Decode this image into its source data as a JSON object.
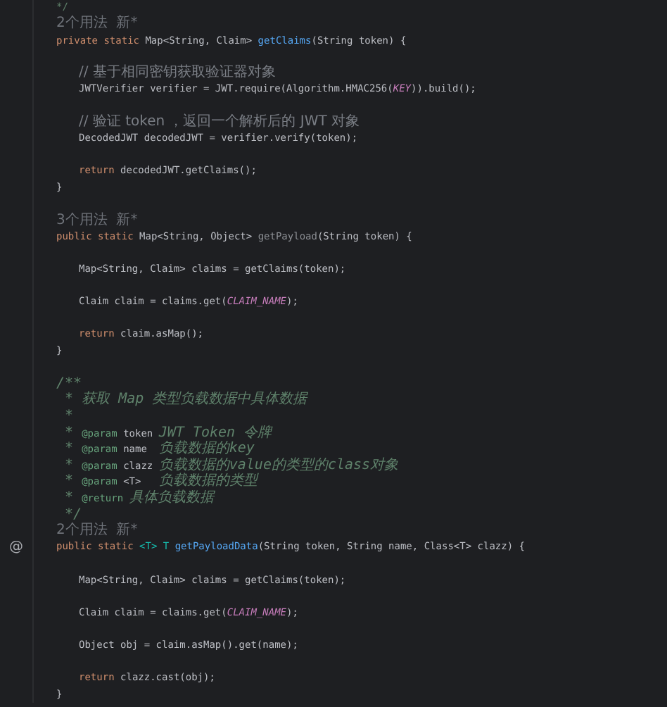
{
  "leading_comment_end": "*/",
  "members": [
    {
      "usage": "2个用法  新*",
      "signature": [
        {
          "text": "private static ",
          "kind": "kw"
        },
        {
          "text": "Map<String, Claim> ",
          "kind": "plain"
        },
        {
          "text": "getClaims",
          "kind": "fn"
        },
        {
          "text": "(String token) {",
          "kind": "plain"
        }
      ],
      "body": [
        {
          "comment": "// 基于相同密钥获取验证器对象",
          "code": [
            {
              "text": "JWTVerifier verifier = JWT.require(Algorithm.HMAC256(",
              "kind": "plain"
            },
            {
              "text": "KEY",
              "kind": "const"
            },
            {
              "text": ")).build();",
              "kind": "plain"
            }
          ]
        },
        {
          "comment": "// 验证 token ，返回一个解析后的 JWT 对象",
          "code": [
            {
              "text": "DecodedJWT decodedJWT = verifier.verify(token);",
              "kind": "plain"
            }
          ]
        },
        {
          "code": [
            {
              "text": "return ",
              "kind": "kw"
            },
            {
              "text": "decodedJWT.getClaims();",
              "kind": "plain"
            }
          ]
        }
      ],
      "closing": "}"
    },
    {
      "usage": "3个用法  新*",
      "signature": [
        {
          "text": "public static ",
          "kind": "kw"
        },
        {
          "text": "Map<String, Object> ",
          "kind": "plain"
        },
        {
          "text": "getPayload",
          "kind": "unused"
        },
        {
          "text": "(String token) {",
          "kind": "plain"
        }
      ],
      "body": [
        {
          "code": [
            {
              "text": "Map<String, Claim> claims = getClaims(token);",
              "kind": "plain"
            }
          ]
        },
        {
          "code": [
            {
              "text": "Claim claim = claims.get(",
              "kind": "plain"
            },
            {
              "text": "CLAIM_NAME",
              "kind": "const"
            },
            {
              "text": ");",
              "kind": "plain"
            }
          ]
        },
        {
          "code": [
            {
              "text": "return ",
              "kind": "kw"
            },
            {
              "text": "claim.asMap();",
              "kind": "plain"
            }
          ]
        }
      ],
      "closing": "}"
    },
    {
      "doc": [
        [
          {
            "text": "/**",
            "kind": "doc"
          }
        ],
        [
          {
            "text": " * ",
            "kind": "doc"
          },
          {
            "text": "获取 Map 类型负载数据中具体数据",
            "kind": "doc"
          }
        ],
        [
          {
            "text": " *",
            "kind": "doc"
          }
        ],
        [
          {
            "text": " * ",
            "kind": "doc"
          },
          {
            "text": "@param ",
            "kind": "tag"
          },
          {
            "text": "token ",
            "kind": "docp"
          },
          {
            "text": "JWT Token 令牌",
            "kind": "doc"
          }
        ],
        [
          {
            "text": " * ",
            "kind": "doc"
          },
          {
            "text": "@param ",
            "kind": "tag"
          },
          {
            "text": "name  ",
            "kind": "docp"
          },
          {
            "text": "负载数据的key",
            "kind": "doc"
          }
        ],
        [
          {
            "text": " * ",
            "kind": "doc"
          },
          {
            "text": "@param ",
            "kind": "tag"
          },
          {
            "text": "clazz ",
            "kind": "docp"
          },
          {
            "text": "负载数据的value的类型的class对象",
            "kind": "doc"
          }
        ],
        [
          {
            "text": " * ",
            "kind": "doc"
          },
          {
            "text": "@param ",
            "kind": "tag"
          },
          {
            "text": "<T>   ",
            "kind": "docp"
          },
          {
            "text": "负载数据的类型",
            "kind": "doc"
          }
        ],
        [
          {
            "text": " * ",
            "kind": "doc"
          },
          {
            "text": "@return ",
            "kind": "tag"
          },
          {
            "text": "具体负载数据",
            "kind": "doc"
          }
        ],
        [
          {
            "text": " */",
            "kind": "doc"
          }
        ]
      ],
      "usage": "2个用法  新*",
      "gutter_mark": "@",
      "signature": [
        {
          "text": "public static ",
          "kind": "kw"
        },
        {
          "text": "<T> T ",
          "kind": "tp"
        },
        {
          "text": "getPayloadData",
          "kind": "fn"
        },
        {
          "text": "(String token, String name, Class<T> clazz) {",
          "kind": "plain"
        }
      ],
      "body": [
        {
          "code": [
            {
              "text": "Map<String, Claim> claims = getClaims(token);",
              "kind": "plain"
            }
          ]
        },
        {
          "code": [
            {
              "text": "Claim claim = claims.get(",
              "kind": "plain"
            },
            {
              "text": "CLAIM_NAME",
              "kind": "const"
            },
            {
              "text": ");",
              "kind": "plain"
            }
          ]
        },
        {
          "code": [
            {
              "text": "Object obj = claim.asMap().get(name);",
              "kind": "plain"
            }
          ]
        },
        {
          "code": [
            {
              "text": "return ",
              "kind": "kw"
            },
            {
              "text": "clazz.cast(obj);",
              "kind": "plain"
            }
          ]
        }
      ],
      "closing": "}"
    }
  ]
}
